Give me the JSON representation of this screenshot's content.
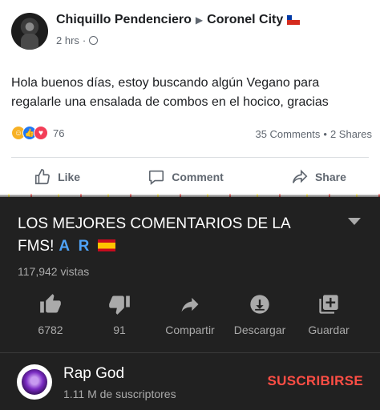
{
  "post": {
    "author": "Chiquillo Pendenciero",
    "target": "Coronel City",
    "time": "2 hrs",
    "dot": "·",
    "text": "Hola buenos días, estoy buscando algún Vegano para regalarle una ensalada de combos en el hocico, gracias",
    "reaction_count": "76",
    "comments": "35 Comments",
    "shares": "2 Shares",
    "stats_dot": "•",
    "actions": {
      "like": "Like",
      "comment": "Comment",
      "share": "Share"
    }
  },
  "video": {
    "title": "LOS MEJORES COMENTARIOS DE LA FMS!",
    "title_badge": "A R",
    "views": "117,942 vistas",
    "actions": {
      "like_count": "6782",
      "dislike_count": "91",
      "share": "Compartir",
      "download": "Descargar",
      "save": "Guardar"
    }
  },
  "channel": {
    "name": "Rap God",
    "subscribers": "1.11 M de suscriptores",
    "subscribe_label": "SUSCRIBIRSE"
  },
  "colors": {
    "facebook_bg": "#ffffff",
    "youtube_bg": "#212121",
    "subscribe_red": "#ff4e45",
    "badge_blue": "#4fa3f7"
  }
}
